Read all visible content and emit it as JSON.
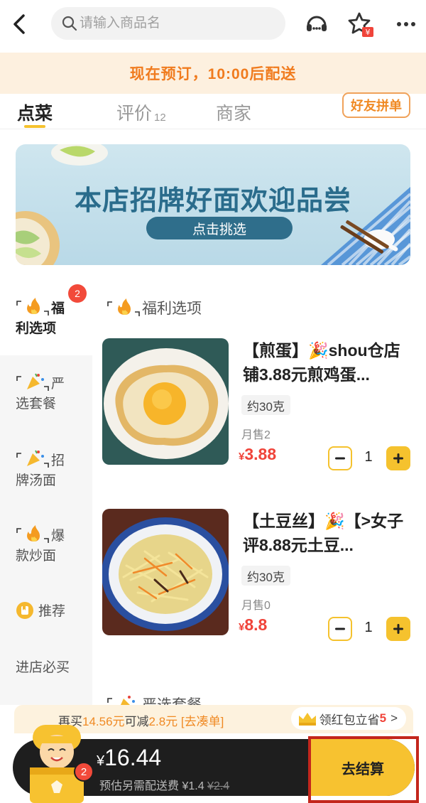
{
  "search": {
    "placeholder": "请输入商品名"
  },
  "notice": "现在预订，10:00后配送",
  "tabs": [
    {
      "label": "点菜"
    },
    {
      "label": "评价",
      "count": "12"
    },
    {
      "label": "商家"
    }
  ],
  "group_order_label": "好友拼单",
  "banner": {
    "title": "本店招牌好面欢迎品尝",
    "cta": "点击挑选"
  },
  "sidebar": {
    "items": [
      {
        "line1": "福",
        "line2": "利选项",
        "badge": "2"
      },
      {
        "line1": "严",
        "line2": "选套餐"
      },
      {
        "line1": "招",
        "line2": "牌汤面"
      },
      {
        "line1": "爆",
        "line2": "款炒面"
      },
      {
        "label": "推荐"
      },
      {
        "label": "进店必买"
      }
    ]
  },
  "section_title": "福利选项",
  "products": [
    {
      "name": "【煎蛋】🎉shou仓店铺3.88元煎鸡蛋...",
      "spec": "约30克",
      "sales": "月售2",
      "price_symbol": "¥",
      "price": "3.88",
      "quantity": "1"
    },
    {
      "name": "【土豆丝】🎉【>女子评8.88元土豆...",
      "spec": "约30克",
      "sales": "月售0",
      "price_symbol": "¥",
      "price": "8.8",
      "quantity": "1"
    }
  ],
  "next_section_title": "严选套餐",
  "promo": {
    "prefix": "再买",
    "amount": "14.56元",
    "middle": "可减",
    "discount": "2.8元",
    "link": "[去凑单]",
    "redpack_label": "领红包立省",
    "redpack_num": "5",
    "redpack_arrow": ">"
  },
  "cart": {
    "badge": "2",
    "total_symbol": "¥",
    "total": "16.44",
    "fee_label": "预估另需配送费 ¥1.4",
    "fee_original": "¥2.4",
    "checkout_label": "去结算"
  },
  "colors": {
    "accent": "#f5c22e",
    "price": "#f0443a",
    "notice": "#f07b1e"
  }
}
